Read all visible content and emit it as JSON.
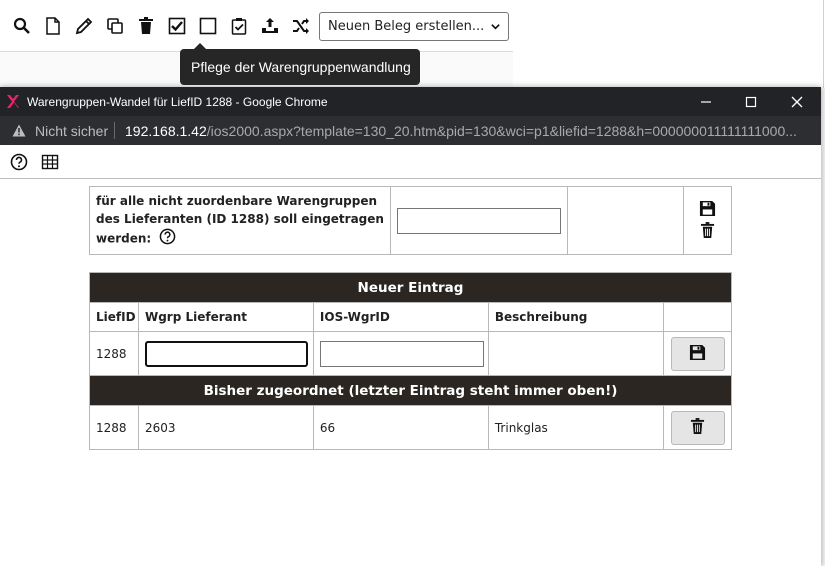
{
  "toolbar": {
    "icons": [
      "search-icon",
      "new-document-icon",
      "pencil-icon",
      "copy-icon",
      "trash-icon",
      "checkbox-checked-icon",
      "checkbox-empty-icon",
      "clipboard-check-icon",
      "export-icon",
      "shuffle-icon"
    ],
    "select_value": "Neuen Beleg erstellen...",
    "tooltip": "Pflege der Warengruppenwandlung"
  },
  "window": {
    "title": "Warengruppen-Wandel für LiefID 1288 - Google Chrome",
    "security": "Nicht sicher",
    "url_host": "192.168.1.42",
    "url_path": "/ios2000.aspx?template=130_20.htm&pid=130&wci=p1&liefid=1288&h=000000011111111000...",
    "title_color": "#222326"
  },
  "default_row": {
    "label": "für alle nicht zuordenbare Warengruppen des Lieferanten (ID 1288) soll eingetragen werden:",
    "input_value": ""
  },
  "new_entry": {
    "heading": "Neuer Eintrag",
    "columns": [
      "LiefID",
      "Wgrp Lieferant",
      "IOS-WgrID",
      "Beschreibung"
    ],
    "liefid": "1288",
    "wgrp_value": "",
    "ios_value": ""
  },
  "assigned": {
    "heading": "Bisher zugeordnet (letzter Eintrag steht immer oben!)",
    "rows": [
      {
        "liefid": "1288",
        "wgrp": "2603",
        "ios": "66",
        "beschreibung": "Trinkglas"
      }
    ]
  },
  "colors": {
    "header_bg": "#2b2621",
    "accent_logo": "#e8256b"
  }
}
